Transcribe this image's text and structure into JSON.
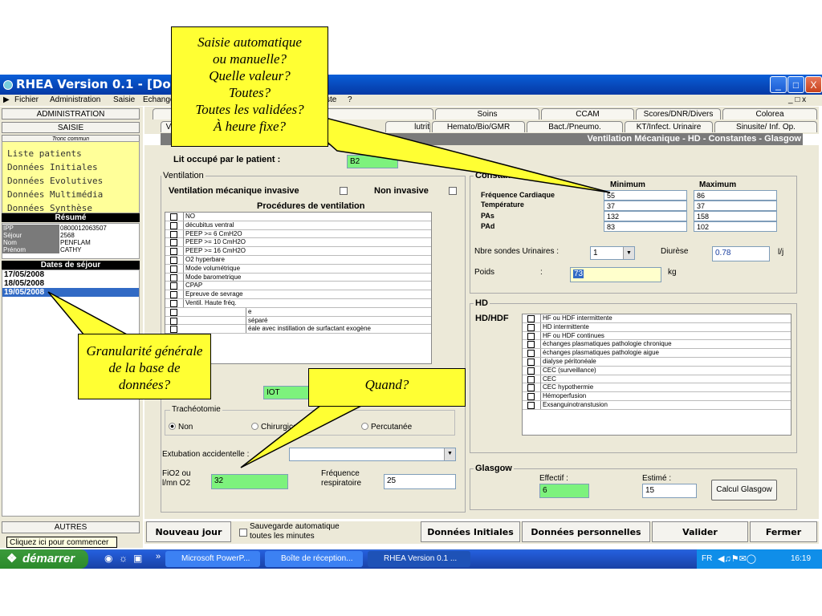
{
  "window": {
    "title": "RHEA Version 0.1 - [Donnée",
    "buttons": {
      "minimize": "_",
      "maximize": "□",
      "close": "X"
    },
    "menu": [
      "Fichier",
      "Administration",
      "Saisie",
      "Echange",
      "ste",
      "?"
    ],
    "menu_right": "_ □ x"
  },
  "left": {
    "administration": "ADMINISTRATION",
    "saisie": "SAISIE",
    "tronc": "Tronc commun",
    "nav": [
      "Liste patients",
      "Données Initiales",
      "Données Evolutives",
      "Données Multimédia",
      "Données Synthèse"
    ],
    "resume_title": "Résumé",
    "patient": [
      {
        "k": "IPP",
        "v": "0800012063507"
      },
      {
        "k": "Séjour",
        "v": "2568"
      },
      {
        "k": "Nom",
        "v": "PENFLAM"
      },
      {
        "k": "Prénom",
        "v": "CATHY"
      }
    ],
    "dates_title": "Dates de séjour",
    "dates": [
      "17/05/2008",
      "18/05/2008",
      "19/05/2008"
    ],
    "autres": "AUTRES",
    "tooltip": "Cliquez ici pour commencer"
  },
  "tabs": {
    "row1": [
      "Examens/Transp.",
      "Soins",
      "CCAM",
      "Scores/DNR/Divers",
      "Colorea"
    ],
    "row2": [
      "V",
      "lutrit",
      "Hemato/Bio/GMR",
      "Bact./Pneumo.",
      "KT/Infect. Urinaire",
      "Sinusite/ Inf. Op."
    ]
  },
  "header": "Ventilation Mécanique - HD - Constantes - Glasgow",
  "lit": {
    "label": "Lit occupé par le patient :",
    "value": "B2"
  },
  "ventilation": {
    "legend": "Ventilation",
    "vmi": "Ventilation mécanique invasive",
    "ni": "Non invasive",
    "proc_title": "Procédures de ventilation",
    "procedures": [
      "NO",
      "décubitus ventral",
      "PEEP >= 6 CmH2O",
      "PEEP >= 10 CmH2O",
      "PEEP >= 16 CmH2O",
      "O2 hyperbare",
      "Mode volumétrique",
      "Mode barometrique",
      "CPAP",
      "Epreuve de sevrage",
      "Ventil. Haute fréq.",
      "e",
      "séparé",
      "éale avec instillation de surfactant exogène"
    ],
    "iot": "IOT",
    "tracheo": {
      "legend": "Trachéotomie",
      "opts": [
        "Non",
        "Chirurgica",
        "Percutanée"
      ]
    },
    "extubation": "Extubation accidentelle :",
    "fio2_label1": "FiO2 ou",
    "fio2_label2": "l/mn O2",
    "fio2": "32",
    "freq_label1": "Fréquence",
    "freq_label2": "respiratoire",
    "freq": "25"
  },
  "constantes": {
    "legend": "Constantes",
    "min": "Minimum",
    "max": "Maximum",
    "rows": [
      {
        "label": "Fréquence Cardiaque",
        "min": "55",
        "max": "86"
      },
      {
        "label": "Température",
        "min": "37",
        "max": "37"
      },
      {
        "label": "PAs",
        "min": "132",
        "max": "158"
      },
      {
        "label": "PAd",
        "min": "83",
        "max": "102"
      }
    ],
    "sondes_label": "Nbre sondes Urinaires :",
    "sondes": "1",
    "diurese_label": "Diurèse",
    "diurese": "0.78",
    "diurese_unit": "l/j",
    "poids_label": "Poids",
    "poids_colon": ":",
    "poids": "73",
    "poids_unit": "kg"
  },
  "hd": {
    "legend": "HD",
    "label": "HD/HDF",
    "items": [
      "HF ou HDF intermittente",
      "HD intermittente",
      "HF ou HDF continues",
      "échanges plasmatiques pathologie chronique",
      "échanges plasmatiques pathologie aigue",
      "dialyse péritonéale",
      "CEC (surveillance)",
      "CEC",
      "CEC hypothermie",
      "Hémoperfusion",
      "Exsanguinotranstusion"
    ]
  },
  "glasgow": {
    "legend": "Glasgow",
    "effectif_label": "Effectif :",
    "effectif": "6",
    "estime_label": "Estimé :",
    "estime": "15",
    "button": "Calcul Glasgow"
  },
  "bottom": {
    "nouveau": "Nouveau jour",
    "sauvegarde1": "Sauvegarde automatique",
    "sauvegarde2": "toutes les minutes",
    "initiales": "Données Initiales",
    "perso": "Données personnelles",
    "valider": "Valider",
    "fermer": "Fermer"
  },
  "taskbar": {
    "start": "démarrer",
    "tasks": [
      "Microsoft PowerP...",
      "Boîte de réception...",
      "RHEA Version 0.1 ..."
    ],
    "lang": "FR",
    "time": "16:19"
  },
  "callouts": {
    "saisie": [
      "Saisie automatique",
      "ou manuelle?",
      "Quelle valeur?",
      "Toutes?",
      "Toutes les validées?",
      "À heure fixe?"
    ],
    "granularite": [
      "Granularité générale",
      "de la base de",
      "données?"
    ],
    "quand": "Quand?"
  },
  "colors": {
    "accent_green": "#7df27d",
    "callout_yellow": "#ffff33",
    "title_blue": "#0a5fd8"
  }
}
